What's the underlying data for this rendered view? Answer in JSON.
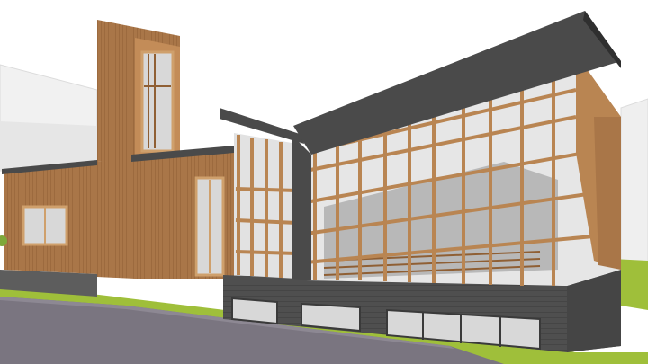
{
  "scene": {
    "subject": "church-building-3d-model",
    "colors": {
      "sky": "#ffffff",
      "background_building": "#f1f1f1",
      "background_building_shade": "#d9d9d9",
      "lawn": "#9fbf3a",
      "lawn_dark": "#86a52f",
      "road": "#7a7580",
      "road_edge": "#8d8893",
      "wood": "#b98552",
      "wood_light": "#cfa06c",
      "wood_dark": "#8f5f34",
      "wood_siding": "#a97648",
      "roof": "#4a4a4a",
      "roof_edge": "#2f2f2f",
      "concrete": "#4f4f4f",
      "concrete_light": "#5d5d5d",
      "glass": "#d8d8d8",
      "interior": "#b8b8b8",
      "window_frame": "#3a3a3a"
    }
  }
}
